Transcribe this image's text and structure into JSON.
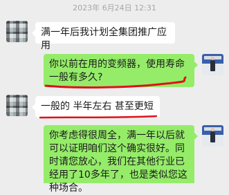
{
  "chat": {
    "timestamp": "2023年 6月24日 12:31",
    "messages": [
      {
        "sender": "other",
        "text": "满一年后我计划全集团推广应用"
      },
      {
        "sender": "self",
        "text": "你以前在用的变频器，使用寿命一般有多久?"
      },
      {
        "sender": "other",
        "text": "一般的 半年左右 甚至更短"
      },
      {
        "sender": "self",
        "text": "你考虑得很周全，满一年以后就可以证明咱们这个确实很好。同时请您放心，我们在其他行业已经用了10多年了，也是类似您这种场合。"
      }
    ]
  },
  "colors": {
    "background": "#ededed",
    "incoming_bubble": "#ffffff",
    "outgoing_bubble": "#95ec69",
    "annotation": "#e0101a"
  }
}
